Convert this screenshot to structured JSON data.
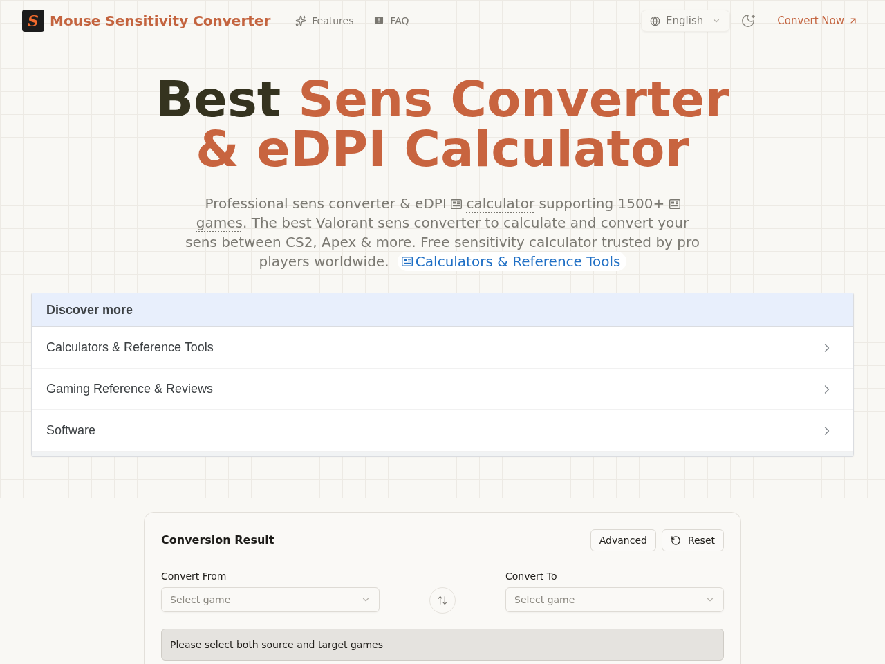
{
  "nav": {
    "logo": "S",
    "brand": "Mouse Sensitivity Converter",
    "links": [
      {
        "label": "Features"
      },
      {
        "label": "FAQ"
      }
    ],
    "language": {
      "value": "English"
    },
    "cta": "Convert Now"
  },
  "hero": {
    "title_lines": [
      [
        {
          "text": "Best",
          "accent": false
        },
        {
          "text": "Sens Converter",
          "accent": true
        }
      ],
      [
        {
          "text": "& eDPI Calculator",
          "accent": true
        }
      ]
    ],
    "description": [
      {
        "kind": "text",
        "text": "Professional sens converter & eDPI"
      },
      {
        "kind": "term",
        "text": "calculator"
      },
      {
        "kind": "text",
        "text": " supporting 1500+"
      },
      {
        "kind": "term",
        "text": "games"
      },
      {
        "kind": "text",
        "text": ". The best Valorant sens converter to calculate and convert your sens between CS2, Apex & more. Free sensitivity calculator trusted by pro players worldwide."
      },
      {
        "kind": "link",
        "text": "Calculators & Reference Tools"
      }
    ]
  },
  "discover": {
    "title": "Discover more",
    "items": [
      {
        "label": "Calculators & Reference Tools"
      },
      {
        "label": "Gaming Reference & Reviews"
      },
      {
        "label": "Software"
      }
    ]
  },
  "converter": {
    "title": "Conversion Result",
    "buttons": [
      {
        "label": "Advanced"
      },
      {
        "label": "Reset"
      }
    ],
    "from": {
      "label": "Convert From",
      "placeholder": "Select game"
    },
    "to": {
      "label": "Convert To",
      "placeholder": "Select game"
    },
    "message": "Please select both source and target games"
  }
}
